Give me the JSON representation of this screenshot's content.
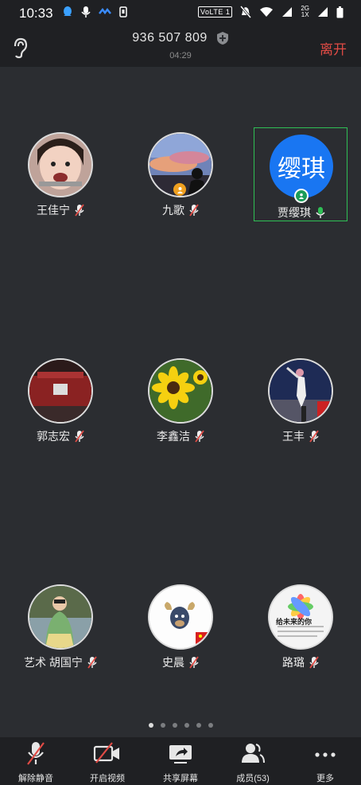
{
  "status_bar": {
    "time": "10:33",
    "volte": "VoLTE 1",
    "network": "2G 1X"
  },
  "header": {
    "meeting_id": "936 507 809",
    "duration": "04:29",
    "leave_label": "离开"
  },
  "participants": [
    {
      "name": "王佳宁",
      "mic": "muted",
      "avatar": "photo-child"
    },
    {
      "name": "九歌",
      "mic": "muted",
      "avatar": "photo-sunset",
      "host": true
    },
    {
      "name": "贾缨琪",
      "mic": "active",
      "avatar_text": "缨琪",
      "avatar_color": "#1976f2",
      "host": true,
      "highlighted": true
    },
    {
      "name": "郭志宏",
      "mic": "muted",
      "avatar": "photo-building"
    },
    {
      "name": "李鑫洁",
      "mic": "muted",
      "avatar": "photo-sunflower"
    },
    {
      "name": "王丰",
      "mic": "muted",
      "avatar": "photo-sport"
    },
    {
      "name": "艺术 胡国宁",
      "mic": "muted",
      "avatar": "photo-lady"
    },
    {
      "name": "史晨",
      "mic": "muted",
      "avatar": "photo-cartoon"
    },
    {
      "name": "路璐",
      "mic": "muted",
      "avatar": "photo-flower",
      "avatar_text": "给未来的你"
    }
  ],
  "pagination": {
    "total": 6,
    "current": 0
  },
  "toolbar": {
    "unmute": "解除静音",
    "video": "开启视频",
    "share": "共享屏幕",
    "members": "成员(53)",
    "more": "更多"
  },
  "colors": {
    "accent_green": "#2fbf55",
    "leave_red": "#e04b45",
    "mute_red": "#e04b45",
    "host_orange": "#f0a020"
  }
}
